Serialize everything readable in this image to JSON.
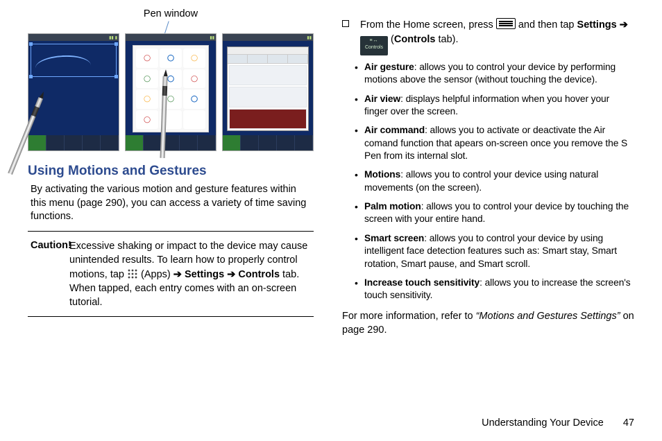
{
  "left": {
    "caption": "Pen window",
    "heading": "Using Motions and Gestures",
    "intro": "By activating the various motion and gesture features within this menu (page 290), you can access a variety of time saving functions.",
    "caution_label": "Caution!",
    "caution_pre": "Excessive shaking or impact to the device may cause unintended results. To learn how to properly control motions, tap ",
    "caution_apps": "(Apps)",
    "caution_arrow": " ➔ ",
    "caution_settings": "Settings",
    "caution_arrow2": " ➔ ",
    "caution_controls": "Controls",
    "caution_tab": " tab. When tapped, each entry comes with an on-screen tutorial."
  },
  "right": {
    "lead_pre": "From the Home screen, press ",
    "lead_mid": " and then tap ",
    "lead_settings": "Settings",
    "lead_arrow": " ➔ ",
    "controls_chip_label": "Controls",
    "lead_post_open": " (",
    "lead_controls": "Controls",
    "lead_post_close": " tab).",
    "items": [
      {
        "t": "Air gesture",
        "d": ": allows you to control your device by performing motions above the sensor (without touching the device)."
      },
      {
        "t": "Air view",
        "d": ": displays helpful information when you hover your finger over the screen."
      },
      {
        "t": "Air command",
        "d": ": allows you to activate or deactivate the Air comand function that apears on-screen once you remove the S Pen from its internal slot."
      },
      {
        "t": "Motions",
        "d": ": allows you to control your device using natural movements (on the screen)."
      },
      {
        "t": "Palm motion",
        "d": ": allows you to control your device by touching the screen with your entire hand."
      },
      {
        "t": "Smart screen",
        "d": ": allows you to control your device by using intelligent face detection features such as: Smart stay, Smart rotation, Smart pause, and Smart scroll."
      },
      {
        "t": "Increase touch sensitivity",
        "d": ": allows you to increase the screen's touch sensitivity."
      }
    ],
    "ref_pre": "For more information, refer to ",
    "ref_title": "“Motions and Gestures Settings”",
    "ref_post": "  on page 290."
  },
  "footer": {
    "section": "Understanding Your Device",
    "page": "47"
  }
}
